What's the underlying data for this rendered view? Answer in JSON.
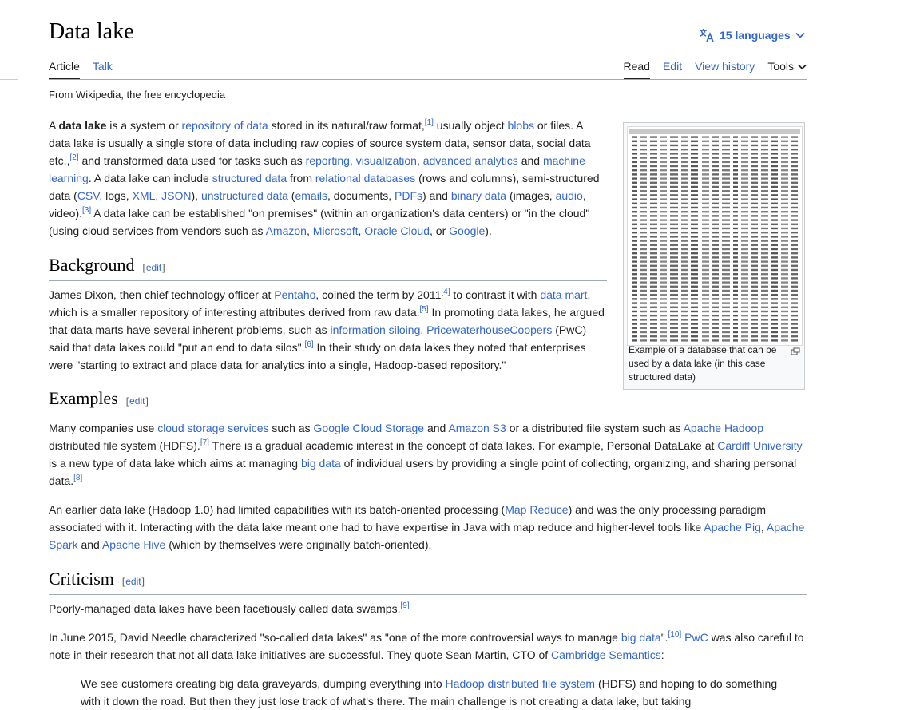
{
  "page": {
    "title": "Data lake",
    "languages_label": "15 languages",
    "tagline": "From Wikipedia, the free encyclopedia"
  },
  "tabs": {
    "article": "Article",
    "talk": "Talk",
    "read": "Read",
    "edit": "Edit",
    "view_history": "View history",
    "tools": "Tools"
  },
  "infobox": {
    "caption": "Example of a database that can be used by a data lake (in this case structured data)"
  },
  "sections": {
    "background": "Background",
    "examples": "Examples",
    "criticism": "Criticism",
    "edit_label": "edit"
  },
  "intro": {
    "t1": "A ",
    "bold": "data lake",
    "t2": " is a system or ",
    "l_repo": "repository of data",
    "t3": " stored in its natural/raw format,",
    "ref1": "[1]",
    "t4": " usually object ",
    "l_blobs": "blobs",
    "t5": " or files. A data lake is usually a single store of data including raw copies of source system data, sensor data, social data etc.,",
    "ref2": "[2]",
    "t6": " and transformed data used for tasks such as ",
    "l_reporting": "reporting",
    "t7": ", ",
    "l_visualization": "visualization",
    "t8": ", ",
    "l_advanced": "advanced analytics",
    "t9": " and ",
    "l_ml": "machine learning",
    "t10": ". A data lake can include ",
    "l_structured": "structured data",
    "t11": " from ",
    "l_relational": "relational databases",
    "t12": " (rows and columns), semi-structured data (",
    "l_csv": "CSV",
    "t13": ", logs, ",
    "l_xml": "XML",
    "t14": ", ",
    "l_json": "JSON",
    "t15": "), ",
    "l_unstructured": "unstructured data",
    "t16": " (",
    "l_emails": "emails",
    "t17": ", documents, ",
    "l_pdfs": "PDFs",
    "t18": ") and ",
    "l_binary": "binary data",
    "t19": " (images, ",
    "l_audio": "audio",
    "t20": ", video).",
    "ref3": "[3]",
    "t21": " A data lake can be established \"on premises\" (within an organization's data centers) or \"in the cloud\" (using cloud services from vendors such as ",
    "l_amazon": "Amazon",
    "t22": ", ",
    "l_microsoft": "Microsoft",
    "t23": ", ",
    "l_oracle": "Oracle Cloud",
    "t24": ", or ",
    "l_google": "Google",
    "t25": ")."
  },
  "background": {
    "t1": "James Dixon, then chief technology officer at ",
    "l_pentaho": "Pentaho",
    "t2": ", coined the term by 2011",
    "ref4": "[4]",
    "t3": " to contrast it with ",
    "l_datamart": "data mart",
    "t4": ", which is a smaller repository of interesting attributes derived from raw data.",
    "ref5": "[5]",
    "t5": " In promoting data lakes, he argued that data marts have several inherent problems, such as ",
    "l_siloing": "information siloing",
    "t6": ". ",
    "l_pwc": "PricewaterhouseCoopers",
    "t7": " (PwC) said that data lakes could \"put an end to data silos\".",
    "ref6": "[6]",
    "t8": " In their study on data lakes they noted that enterprises were \"starting to extract and place data for analytics into a single, Hadoop-based repository.\""
  },
  "examples": {
    "p1": {
      "t1": "Many companies use ",
      "l_cloud": "cloud storage services",
      "t2": " such as ",
      "l_gcs": "Google Cloud Storage",
      "t3": " and ",
      "l_s3": "Amazon S3",
      "t4": " or a distributed file system such as ",
      "l_hadoop": "Apache Hadoop",
      "t5": " distributed file system (HDFS).",
      "ref7": "[7]",
      "t6": " There is a gradual academic interest in the concept of data lakes. For example, Personal DataLake at ",
      "l_cardiff": "Cardiff University",
      "t7": " is a new type of data lake which aims at managing ",
      "l_bigdata": "big data",
      "t8": " of individual users by providing a single point of collecting, organizing, and sharing personal data.",
      "ref8": "[8]"
    },
    "p2": {
      "t1": "An earlier data lake (Hadoop 1.0) had limited capabilities with its batch-oriented processing (",
      "l_mapreduce": "Map Reduce",
      "t2": ") and was the only processing paradigm associated with it. Interacting with the data lake meant one had to have expertise in Java with map reduce and higher-level tools like ",
      "l_pig": "Apache Pig",
      "t3": ", ",
      "l_spark": "Apache Spark",
      "t4": " and ",
      "l_hive": "Apache Hive",
      "t5": " (which by themselves were originally batch-oriented)."
    }
  },
  "criticism": {
    "p1": {
      "t1": "Poorly-managed data lakes have been facetiously called data swamps.",
      "ref9": "[9]"
    },
    "p2": {
      "t1": "In June 2015, David Needle characterized \"so-called data lakes\" as \"one of the more controversial ways to manage ",
      "l_bigdata": "big data",
      "t2": "\".",
      "ref10": "[10]",
      "t3": " ",
      "l_pwc": "PwC",
      "t4": " was also careful to note in their research that not all data lake initiatives are successful. They quote Sean Martin, CTO of ",
      "l_cambridge": "Cambridge Semantics",
      "t5": ":"
    },
    "quote": {
      "t1": "We see customers creating big data graveyards, dumping everything into ",
      "l_hdfs": "Hadoop distributed file system",
      "t2": " (HDFS) and hoping to do something with it down the road. But then they just lose track of what's there. The main challenge is not creating a data lake, but taking"
    }
  }
}
